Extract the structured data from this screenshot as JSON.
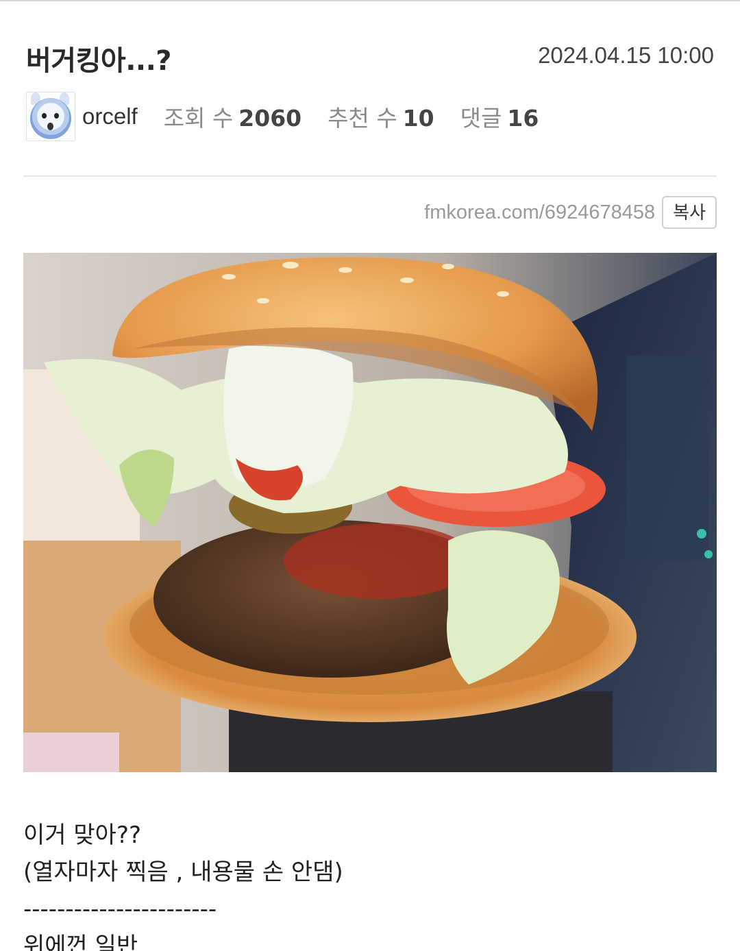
{
  "post": {
    "title": "버거킹아...?",
    "date": "2024.04.15 10:00"
  },
  "meta": {
    "author": "orcelf",
    "views_label": "조회 수",
    "views": "2060",
    "recommend_label": "추천 수",
    "recommend": "10",
    "comments_label": "댓글",
    "comments": "16"
  },
  "link": {
    "url": "fmkorea.com/6924678458",
    "copy_label": "복사"
  },
  "photo": {
    "icon": "burger-photo",
    "colors": {
      "bun": "#e8a152",
      "lettuce": "#dfeec4",
      "tomato": "#e9563c",
      "patty": "#5a3a26"
    }
  },
  "content": {
    "line1": "이거 맞아??",
    "line2": "(열자마자 찍음 , 내용물 손 안댐)",
    "line3": "-----------------------",
    "line4": "위에껀 일반"
  }
}
